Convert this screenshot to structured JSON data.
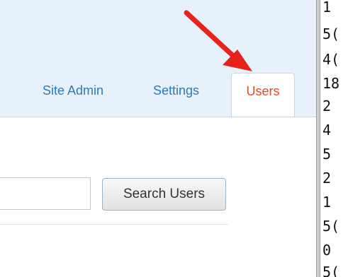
{
  "tabs": {
    "site_admin": "Site Admin",
    "settings": "Settings",
    "users": "Users"
  },
  "search": {
    "value": "",
    "button_label": "Search Users"
  },
  "background_column": {
    "glyphs": [
      "1",
      "5(",
      "4(",
      "18",
      "2",
      "4",
      "5",
      "2",
      "1",
      "5(",
      "0",
      "5("
    ]
  },
  "colors": {
    "header_bg": "#e7f1fb",
    "tab_link": "#2b7bb9",
    "active_tab": "#e8471f",
    "arrow": "#e6221b"
  },
  "annotation": {
    "type": "red-arrow-icon",
    "points_to": "Users"
  }
}
